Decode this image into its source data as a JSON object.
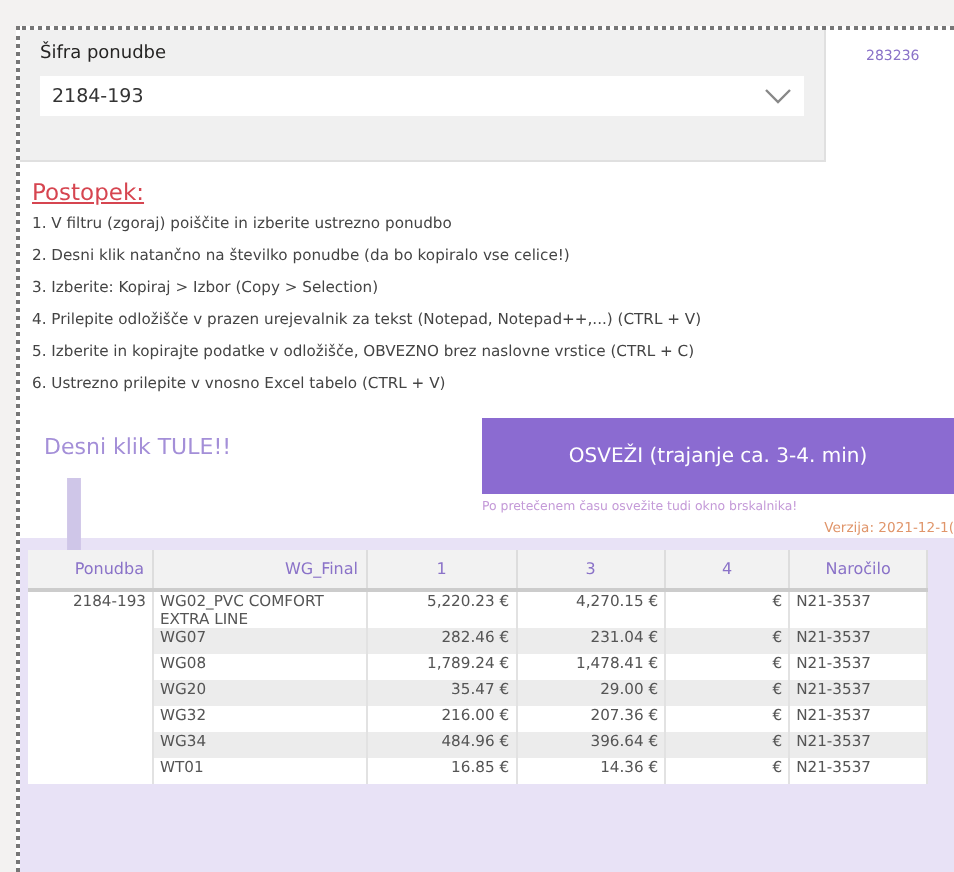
{
  "filter": {
    "label": "Šifra ponudbe",
    "value": "2184-193"
  },
  "code": "283236",
  "instructions": {
    "title": "Postopek:",
    "steps": [
      "1. V filtru (zgoraj) poiščite in izberite ustrezno ponudbo",
      "2. Desni klik natančno na številko ponudbe (da bo kopiralo vse celice!)",
      "3. Izberite: Kopiraj > Izbor (Copy > Selection)",
      "4. Prilepite odložišče v prazen urejevalnik za tekst (Notepad, Notepad++,...) (CTRL + V)",
      "5. Izberite in kopirajte podatke v odložišče, OBVEZNO brez naslovne vrstice (CTRL + C)",
      "6. Ustrezno prilepite v vnosno Excel tabelo (CTRL + V)"
    ]
  },
  "hint": "Desni klik TULE!!",
  "refresh_button": "OSVEŽI (trajanje ca. 3-4. min)",
  "note": "Po pretečenem času osvežite tudi okno brskalnika!",
  "version": "Verzija: 2021-12-1(",
  "table": {
    "columns": [
      "Ponudba",
      "WG_Final",
      "1",
      "3",
      "4",
      "Naročilo"
    ],
    "rows": [
      [
        "2184-193",
        "WG02_PVC COMFORT EXTRA LINE",
        "5,220.23 €",
        "4,270.15 €",
        "€",
        "N21-3537"
      ],
      [
        "",
        "WG07",
        "282.46 €",
        "231.04 €",
        "€",
        "N21-3537"
      ],
      [
        "",
        "WG08",
        "1,789.24 €",
        "1,478.41 €",
        "€",
        "N21-3537"
      ],
      [
        "",
        "WG20",
        "35.47 €",
        "29.00 €",
        "€",
        "N21-3537"
      ],
      [
        "",
        "WG32",
        "216.00 €",
        "207.36 €",
        "€",
        "N21-3537"
      ],
      [
        "",
        "WG34",
        "484.96 €",
        "396.64 €",
        "€",
        "N21-3537"
      ],
      [
        "",
        "WT01",
        "16.85 €",
        "14.36 €",
        "€",
        "N21-3537"
      ]
    ]
  }
}
